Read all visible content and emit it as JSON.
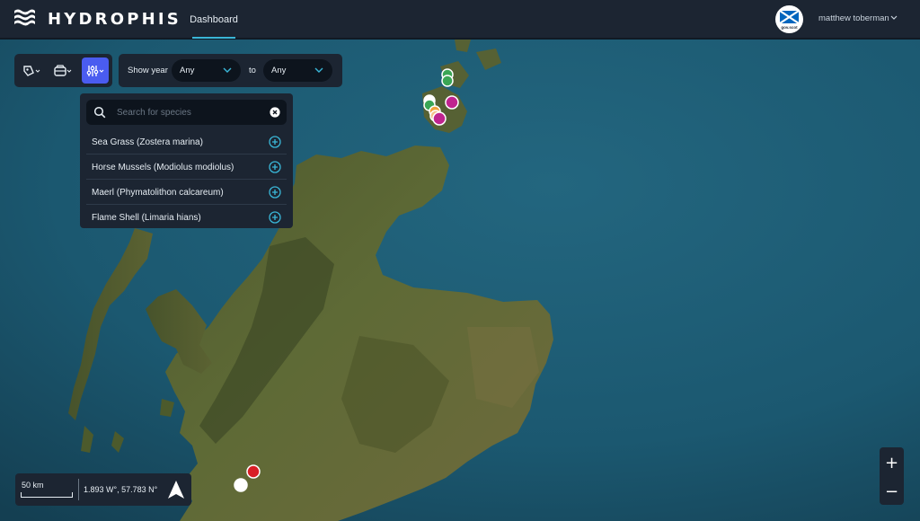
{
  "app": {
    "name": "HYDROPHIS"
  },
  "nav": {
    "tabs": [
      {
        "label": "Dashboard",
        "active": true
      }
    ]
  },
  "user": {
    "name": "matthew toberman",
    "avatar_label": "gov.scot"
  },
  "toolbar": {
    "tools": [
      {
        "icon": "draw-tag-icon",
        "active": false
      },
      {
        "icon": "layers-icon",
        "active": false
      },
      {
        "icon": "filter-sliders-icon",
        "active": true
      }
    ]
  },
  "year_filter": {
    "label": "Show year",
    "from": "Any",
    "to_label": "to",
    "to": "Any"
  },
  "species_search": {
    "placeholder": "Search for species",
    "value": "",
    "items": [
      {
        "label": "Sea Grass (Zostera marina)"
      },
      {
        "label": "Horse Mussels (Modiolus modiolus)"
      },
      {
        "label": "Maerl (Phymatolithon calcareum)"
      },
      {
        "label": "Flame Shell (Limaria hians)"
      }
    ]
  },
  "map": {
    "scale_label": "50 km",
    "coordinates": "1.893 W°, 57.783 N°",
    "zoom_in": "+",
    "zoom_out": "−"
  },
  "colors": {
    "accent": "#3ab7d8",
    "active_tool": "#4a5cf0",
    "panel": "#1c2532",
    "sea": "#1d5a73",
    "marker_green": "#3aa655",
    "marker_magenta": "#c0248f",
    "marker_orange": "#f2a23a",
    "marker_red": "#d81f26"
  }
}
